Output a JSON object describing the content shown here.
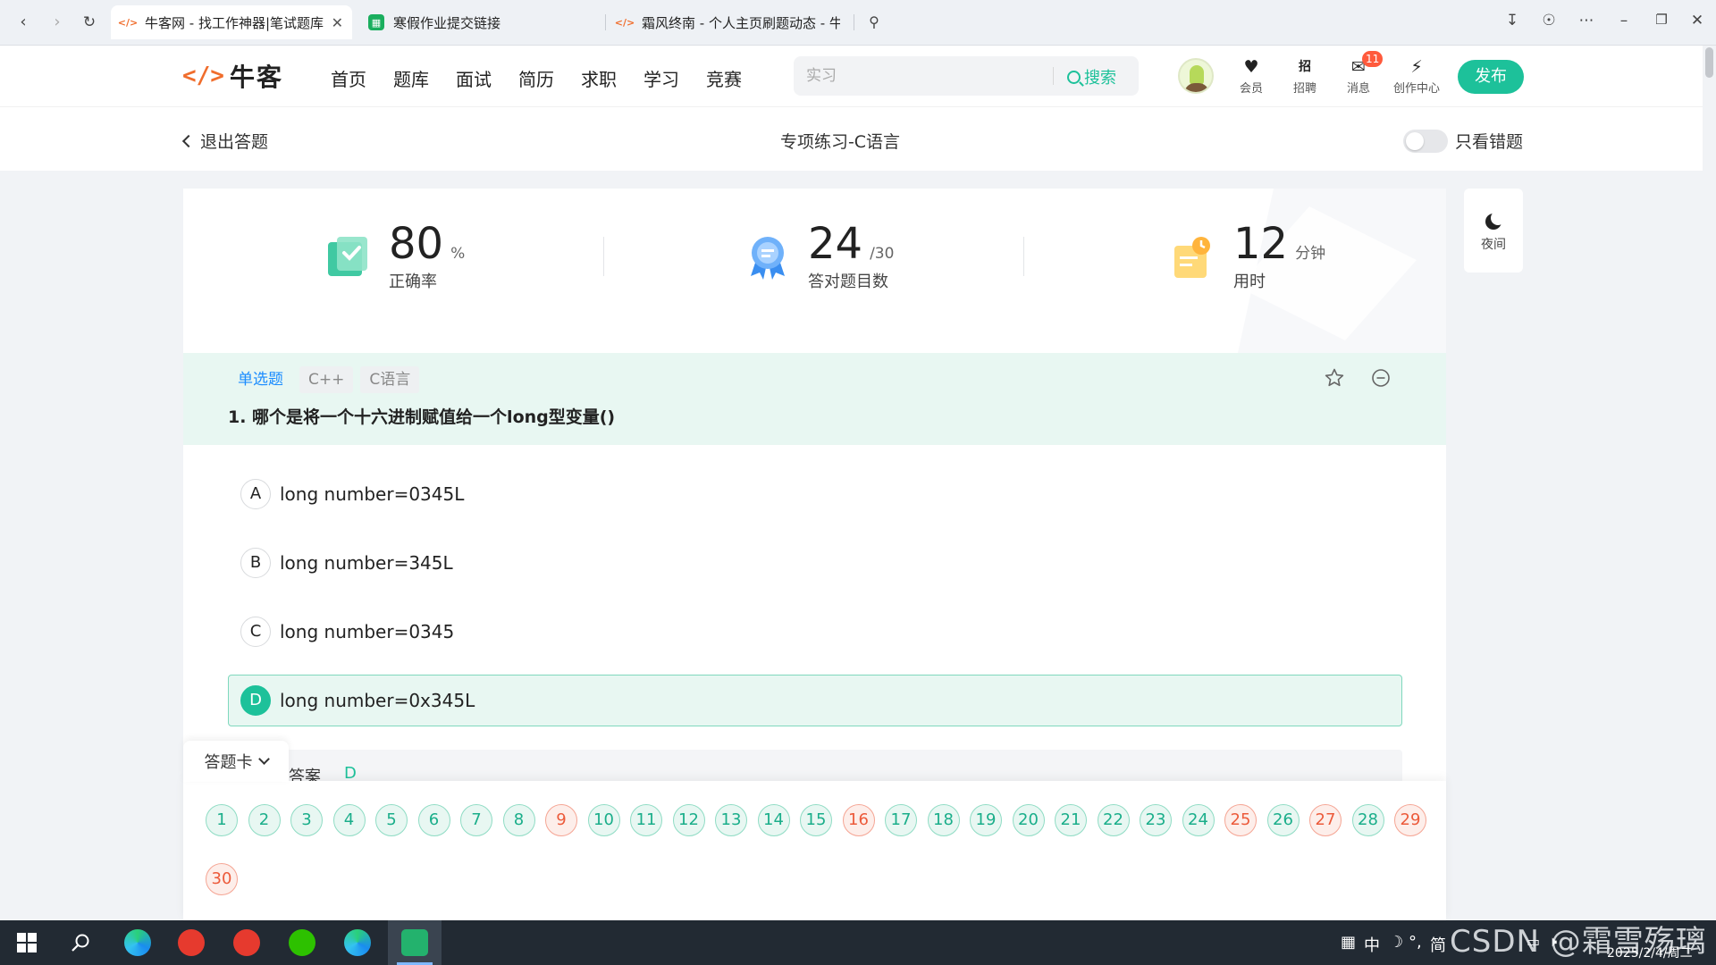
{
  "browser": {
    "tabs": [
      {
        "title": "牛客网 - 找工作神器|笔试题库",
        "active": true
      },
      {
        "title": "寒假作业提交链接",
        "active": false
      },
      {
        "title": "霜风终南 - 个人主页刷题动态 - 牛客",
        "active": false
      }
    ],
    "close_glyph": "✕"
  },
  "site": {
    "logo_mark": "'<",
    "logo_text": "牛客",
    "nav": [
      "首页",
      "题库",
      "面试",
      "简历",
      "求职",
      "学习",
      "竞赛"
    ],
    "search_placeholder": "实习",
    "search_button": "搜索",
    "icons": [
      {
        "name": "vip",
        "label": "会员",
        "glyph": "♥"
      },
      {
        "name": "jobs",
        "label": "招聘",
        "glyph": "招"
      },
      {
        "name": "messages",
        "label": "消息",
        "glyph": "✉",
        "badge": "11"
      },
      {
        "name": "creator",
        "label": "创作中心",
        "glyph": "⚡"
      }
    ],
    "publish": "发布"
  },
  "subheader": {
    "back": "退出答题",
    "title": "专项练习-C语言",
    "toggle_label": "只看错题"
  },
  "stats": {
    "accuracy": {
      "value": "80",
      "unit": "%",
      "label": "正确率"
    },
    "correct": {
      "value": "24",
      "unit": "/30",
      "label": "答对题目数"
    },
    "time": {
      "value": "12",
      "unit": "分钟",
      "label": "用时"
    }
  },
  "question": {
    "type_tag": "单选题",
    "tags": [
      "C++",
      "C语言"
    ],
    "title": "1. 哪个是将一个十六进制赋值给一个long型变量()",
    "options": [
      {
        "letter": "A",
        "text": "long number=0345L",
        "selected": false
      },
      {
        "letter": "B",
        "text": "long number=345L",
        "selected": false
      },
      {
        "letter": "C",
        "text": "long number=0345",
        "selected": false
      },
      {
        "letter": "D",
        "text": "long number=0x345L",
        "selected": true
      }
    ],
    "answer_label": "答案",
    "answer_value": "D"
  },
  "answer_sheet": {
    "label": "答题卡",
    "wrong": [
      9,
      16,
      25,
      27,
      29,
      30
    ],
    "total": 30
  },
  "night_mode": "夜间",
  "taskbar": {
    "tray_text": "中",
    "ime": "简",
    "date": "2025/2/4/周二",
    "watermark": "CSDN @霜雪殇璃"
  }
}
